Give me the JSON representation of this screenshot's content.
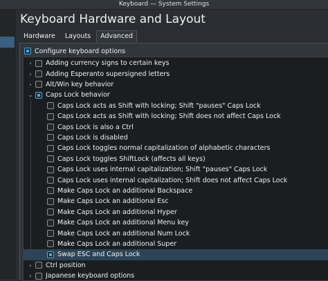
{
  "window": {
    "title": "Keyboard — System Settings"
  },
  "page": {
    "title": "Keyboard Hardware and Layout"
  },
  "tabs": [
    {
      "label": "Hardware",
      "active": false
    },
    {
      "label": "Layouts",
      "active": false
    },
    {
      "label": "Advanced",
      "active": true
    }
  ],
  "configure": {
    "label": "Configure keyboard options",
    "checked": true
  },
  "tree": [
    {
      "label": "Adding currency signs to certain keys",
      "level": 0,
      "expander": "collapsed",
      "checked": false
    },
    {
      "label": "Adding Esperanto supersigned letters",
      "level": 0,
      "expander": "collapsed",
      "checked": false
    },
    {
      "label": "Alt/Win key behavior",
      "level": 0,
      "expander": "collapsed",
      "checked": false
    },
    {
      "label": "Caps Lock behavior",
      "level": 0,
      "expander": "expanded",
      "checked": true
    },
    {
      "label": "Caps Lock acts as Shift with locking; Shift \"pauses\" Caps Lock",
      "level": 1,
      "checked": false
    },
    {
      "label": "Caps Lock acts as Shift with locking; Shift does not affect Caps Lock",
      "level": 1,
      "checked": false
    },
    {
      "label": "Caps Lock is also a Ctrl",
      "level": 1,
      "checked": false
    },
    {
      "label": "Caps Lock is disabled",
      "level": 1,
      "checked": false
    },
    {
      "label": "Caps Lock toggles normal capitalization of alphabetic characters",
      "level": 1,
      "checked": false
    },
    {
      "label": "Caps Lock toggles ShiftLock (affects all keys)",
      "level": 1,
      "checked": false
    },
    {
      "label": "Caps Lock uses internal capitalization; Shift \"pauses\" Caps Lock",
      "level": 1,
      "checked": false
    },
    {
      "label": "Caps Lock uses internal capitalization; Shift does not affect Caps Lock",
      "level": 1,
      "checked": false
    },
    {
      "label": "Make Caps Lock an additional Backspace",
      "level": 1,
      "checked": false
    },
    {
      "label": "Make Caps Lock an additional Esc",
      "level": 1,
      "checked": false
    },
    {
      "label": "Make Caps Lock an additional Hyper",
      "level": 1,
      "checked": false
    },
    {
      "label": "Make Caps Lock an additional Menu key",
      "level": 1,
      "checked": false
    },
    {
      "label": "Make Caps Lock an additional Num Lock",
      "level": 1,
      "checked": false
    },
    {
      "label": "Make Caps Lock an additional Super",
      "level": 1,
      "checked": false
    },
    {
      "label": "Swap ESC and Caps Lock",
      "level": 1,
      "checked": true,
      "selected": true
    },
    {
      "label": "Ctrl position",
      "level": 0,
      "expander": "collapsed",
      "checked": false
    },
    {
      "label": "Japanese keyboard options",
      "level": 0,
      "expander": "collapsed",
      "checked": false
    }
  ],
  "colors": {
    "accent": "#3daee9",
    "selection": "#2d4456",
    "window_bg": "#2a2e32"
  }
}
